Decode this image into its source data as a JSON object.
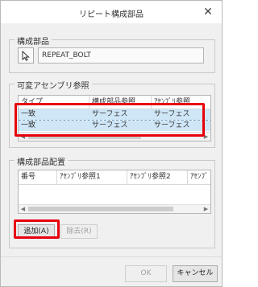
{
  "window": {
    "title": "リピート構成部品",
    "close_glyph": "✕"
  },
  "component_group": {
    "label": "構成部品",
    "field_value": "REPEAT_BOLT"
  },
  "variable_refs_group": {
    "label": "可変アセンブリ参照",
    "headers": [
      "タイプ",
      "構成部品参照",
      "ｱｾﾝﾌﾞﾘ参照"
    ],
    "rows": [
      [
        "一致",
        "サーフェス",
        "サーフェス"
      ],
      [
        "一致",
        "サーフェス",
        "サーフェス"
      ]
    ]
  },
  "placement_group": {
    "label": "構成部品配置",
    "headers": [
      "番号",
      "ｱｾﾝﾌﾞﾘ参照1",
      "ｱｾﾝﾌﾞﾘ参照2",
      "ｱｾﾝﾌﾞ"
    ],
    "add_label": "追加(A)",
    "remove_label": "除去(R)"
  },
  "footer": {
    "ok_label": "OK",
    "cancel_label": "キャンセル"
  },
  "colors": {
    "highlight": "#e8000b",
    "selection": "#cfe6f7"
  }
}
